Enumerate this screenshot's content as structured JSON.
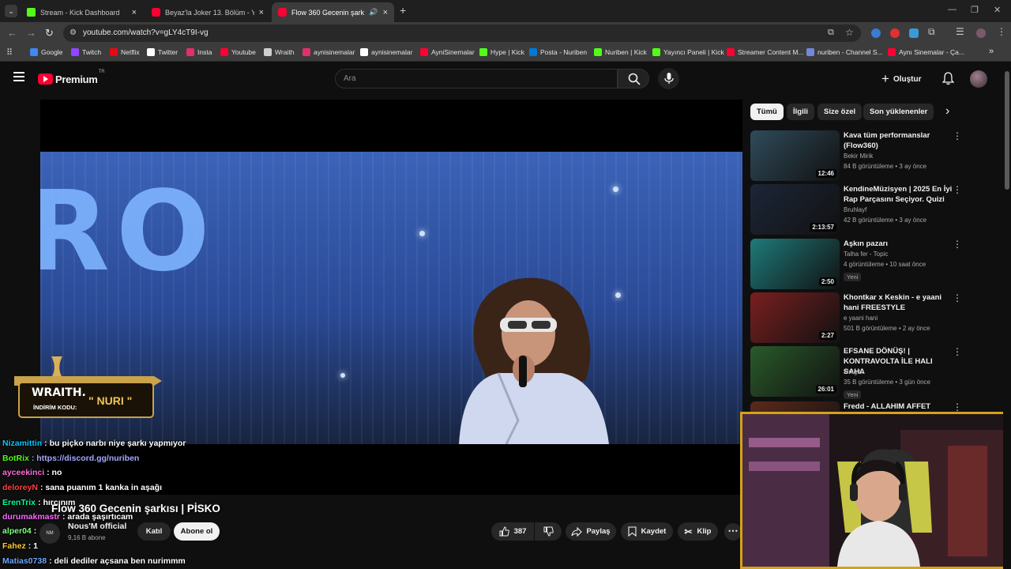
{
  "browser": {
    "tabs": [
      {
        "title": "Stream - Kick Dashboard",
        "color": "#53fc18"
      },
      {
        "title": "Beyaz'la Joker 13. Bölüm - YouT",
        "color": "#ff0033"
      },
      {
        "title": "Flow 360 Gecenin şarkısı | P",
        "color": "#ff0033"
      }
    ],
    "url": "youtube.com/watch?v=gLY4cT9I-vg",
    "bookmarks": [
      {
        "label": "Google",
        "color": "#4285f4"
      },
      {
        "label": "Twitch",
        "color": "#9146ff"
      },
      {
        "label": "Netflix",
        "color": "#e50914"
      },
      {
        "label": "Twitter",
        "color": "#ffffff"
      },
      {
        "label": "Insta",
        "color": "#e1306c"
      },
      {
        "label": "Youtube",
        "color": "#ff0033"
      },
      {
        "label": "Wraith",
        "color": "#cfcfcf"
      },
      {
        "label": "aynisinemalar",
        "color": "#e1306c"
      },
      {
        "label": "aynisinemalar",
        "color": "#ffffff"
      },
      {
        "label": "AyniSinemalar",
        "color": "#ff0033"
      },
      {
        "label": "Hype | Kick",
        "color": "#53fc18"
      },
      {
        "label": "Posta - Nuriben",
        "color": "#0078d4"
      },
      {
        "label": "Nuriben | Kick",
        "color": "#53fc18"
      },
      {
        "label": "Yayıncı Paneli | Kick",
        "color": "#53fc18"
      },
      {
        "label": "Streamer Content M...",
        "color": "#ff0033"
      },
      {
        "label": "nuriben - Channel S...",
        "color": "#7289da"
      },
      {
        "label": "Aynı Sinemalar - Ça...",
        "color": "#ff0033"
      }
    ]
  },
  "youtube": {
    "logo_text": "Premium",
    "logo_region": "TR",
    "search_placeholder": "Ara",
    "create_label": "Oluştur",
    "chips": [
      "Tümü",
      "İlgili",
      "Size özel",
      "Son yüklenenler"
    ],
    "video": {
      "stage_text": "RO",
      "title": "Flow 360 Gecenin şarkısı | PİSKO",
      "channel": "Nous'M official",
      "subscribers": "9,16 B abone",
      "join_label": "Katıl",
      "subscribe_label": "Abone ol",
      "likes": "387",
      "share_label": "Paylaş",
      "save_label": "Kaydet",
      "clip_label": "Klip"
    },
    "recommendations": [
      {
        "title": "Kava tüm performanslar (Flow360)",
        "channel": "Bekir Mirik",
        "meta": "84 B görüntüleme • 3 ay önce",
        "duration": "12:46",
        "badge": "",
        "thumb": "#2f4b5a"
      },
      {
        "title": "KendineMüzisyen | 2025 En İyi Rap Parçasını Seçiyor. Quizi",
        "channel": "Bruhlayf",
        "meta": "42 B görüntüleme • 3 ay önce",
        "duration": "2:13:57",
        "badge": "",
        "thumb": "#1c2638"
      },
      {
        "title": "Aşkın pazarı",
        "channel": "Talha fer - Topic",
        "meta": "4 görüntüleme • 10 saat önce",
        "duration": "2:50",
        "badge": "Yeni",
        "thumb": "#1f7a7a"
      },
      {
        "title": "Khontkar x Keskin - e yaani hani FREESTYLE",
        "channel": "e yaani hani",
        "meta": "501 B görüntüleme • 2 ay önce",
        "duration": "2:27",
        "badge": "",
        "thumb": "#7a1f1f"
      },
      {
        "title": "EFSANE DÖNÜŞ! | KONTRAVOLTA İLE HALI SAHA",
        "channel": "smtgltv",
        "meta": "35 B görüntüleme • 3 gün önce",
        "duration": "26:01",
        "badge": "Yeni",
        "thumb": "#2a5a2a"
      },
      {
        "title": "Fredd - ALLAHIM AFFET",
        "channel": "",
        "meta": "",
        "duration": "",
        "badge": "",
        "thumb": "#5a2a1a"
      }
    ]
  },
  "overlay": {
    "wraith_brand": "WRAITH.",
    "wraith_code_label": "İNDİRİM KODU:",
    "wraith_code": "\" NURI \"",
    "chat": [
      {
        "user": "Nizamittin",
        "msg": ": bu piçko narbı niye şarkı yapmıyor",
        "color": "#00c8ff"
      },
      {
        "user": "BotRix",
        "msg": ": https://discord.gg/nuriben",
        "color": "#53fc18",
        "msgcolor": "#a0a8ff"
      },
      {
        "user": "ayceekinci",
        "msg": ": no",
        "color": "#ff6bd6"
      },
      {
        "user": "deloreyN",
        "msg": ": sana puanım 1 kanka in aşağı",
        "color": "#ff4040"
      },
      {
        "user": "ErenTrix",
        "msg": ": hırcınım",
        "color": "#00ff9d"
      },
      {
        "user": "durumakmastr",
        "msg": ": arada şaşırtıcam",
        "color": "#ff66ff"
      },
      {
        "user": "alper04",
        "msg": ":",
        "color": "#7fff7f"
      },
      {
        "user": "Fahez",
        "msg": ": 1",
        "color": "#ffcc33"
      },
      {
        "user": "Matias0738",
        "msg": ": deli dediler açsana ben nurimmm",
        "color": "#6aa8ff"
      }
    ]
  },
  "icons": [
    "menu-icon",
    "search-icon",
    "mic-icon",
    "plus-icon",
    "bell-icon",
    "like-icon",
    "dislike-icon",
    "share-icon",
    "save-icon",
    "clip-icon",
    "more-icon",
    "chevron-right-icon"
  ]
}
